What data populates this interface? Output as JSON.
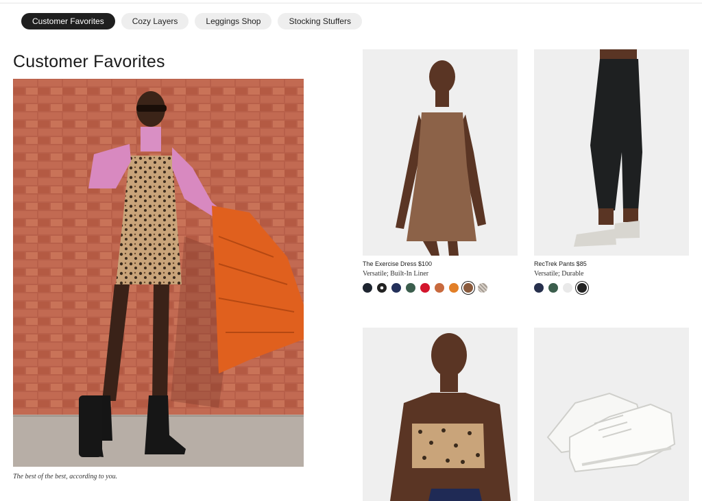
{
  "tabs": [
    {
      "label": "Customer Favorites",
      "active": true
    },
    {
      "label": "Cozy Layers",
      "active": false
    },
    {
      "label": "Leggings Shop",
      "active": false
    },
    {
      "label": "Stocking Stuffers",
      "active": false
    }
  ],
  "section": {
    "title": "Customer Favorites",
    "caption": "The best of the best, according to you."
  },
  "products": [
    {
      "name": "The Exercise Dress $100",
      "desc": "Versatile; Built-In Liner",
      "swatches": [
        "#1e2530",
        "#2a2a2a",
        "#23305a",
        "#3b5e4d",
        "#d3152c",
        "#c86a3e",
        "#e27f27",
        "#8a5a3c",
        "#c9c3bc"
      ],
      "selected": 7
    },
    {
      "name": "RecTrek Pants $85",
      "desc": "Versatile; Durable",
      "swatches": [
        "#27304d",
        "#3b5e4d",
        "#e9e9e9",
        "#222222"
      ],
      "selected": 3
    },
    {
      "name": "",
      "desc": ""
    },
    {
      "name": "",
      "desc": ""
    }
  ]
}
